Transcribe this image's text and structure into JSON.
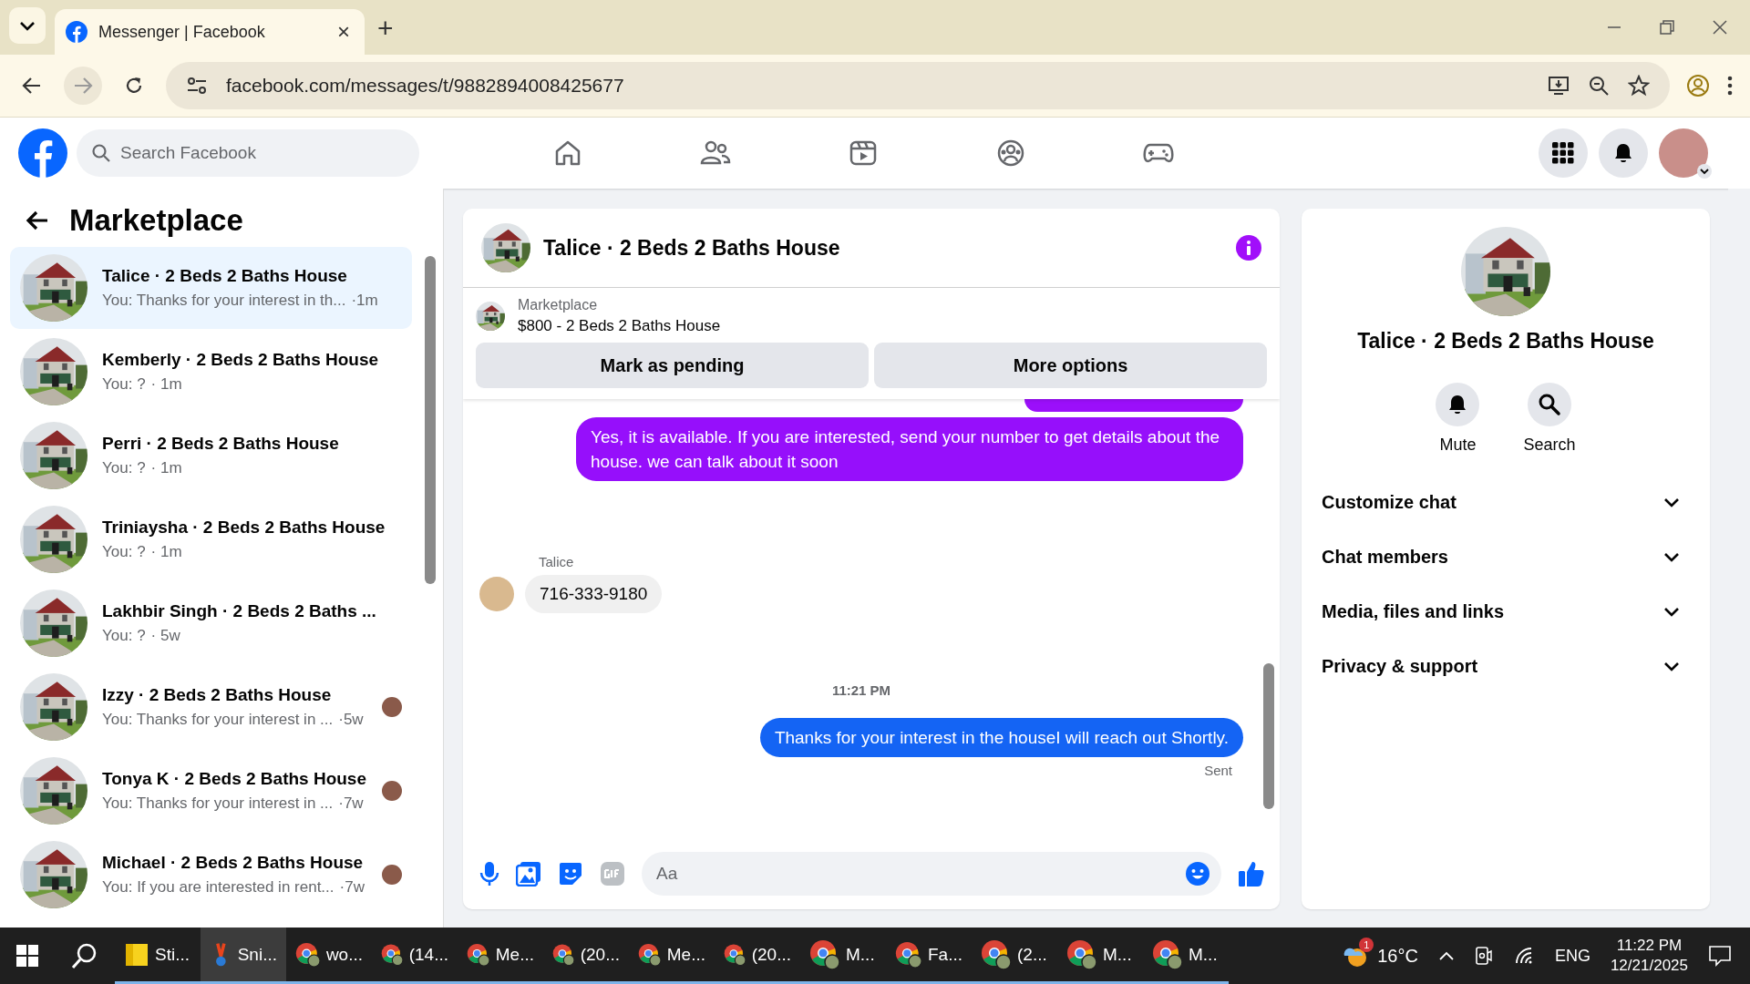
{
  "browser": {
    "tab": {
      "title": "Messenger | Facebook",
      "close": "×"
    },
    "new_tab": "+",
    "url": "facebook.com/messages/t/9882894008425677"
  },
  "header": {
    "search": {
      "placeholder": "Search Facebook"
    }
  },
  "sidebar": {
    "title": "Marketplace",
    "conversations": [
      {
        "name": "Talice · 2 Beds 2 Baths House",
        "preview": "You: Thanks for your interest in th...",
        "time": "·1m",
        "selected": true,
        "seen_avatar": false
      },
      {
        "name": "Kemberly · 2 Beds 2 Baths House",
        "preview": "You: ?",
        "time": "· 1m",
        "selected": false,
        "seen_avatar": false
      },
      {
        "name": "Perri · 2 Beds 2 Baths House",
        "preview": "You: ?",
        "time": "· 1m",
        "selected": false,
        "seen_avatar": false
      },
      {
        "name": "Triniaysha · 2 Beds 2 Baths House",
        "preview": "You: ?",
        "time": "· 1m",
        "selected": false,
        "seen_avatar": false
      },
      {
        "name": "Lakhbir Singh · 2 Beds 2 Baths ...",
        "preview": "You: ?",
        "time": "· 5w",
        "selected": false,
        "seen_avatar": false
      },
      {
        "name": "Izzy · 2 Beds 2 Baths House",
        "preview": "You: Thanks for your interest in ...",
        "time": "·5w",
        "selected": false,
        "seen_avatar": true
      },
      {
        "name": "Tonya K · 2 Beds 2 Baths House",
        "preview": "You: Thanks for your interest in ...",
        "time": "·7w",
        "selected": false,
        "seen_avatar": true
      },
      {
        "name": "Michael · 2 Beds 2 Baths House",
        "preview": "You: If you are interested in rent...",
        "time": "·7w",
        "selected": false,
        "seen_avatar": true
      }
    ]
  },
  "chat": {
    "title": "Talice · 2 Beds 2 Baths House",
    "listing": {
      "source": "Marketplace",
      "title": "$800 - 2 Beds 2 Baths House"
    },
    "actions": [
      "Mark as pending",
      "More options"
    ],
    "messages": [
      {
        "kind": "fragment",
        "color": "#9b0ffa"
      },
      {
        "kind": "outgoing",
        "text": "Yes, it is available. If you are interested, send your number to get details about the house. we can talk about it soon",
        "color": "#960ffb"
      },
      {
        "kind": "incoming",
        "sender": "Talice",
        "text": "716-333-9180"
      },
      {
        "kind": "timestamp",
        "text": "11:21 PM"
      },
      {
        "kind": "outgoing",
        "text": "Thanks for your interest in the houseI will reach out Shortly.",
        "color": "#1464f4",
        "status": "Sent"
      }
    ],
    "composer": {
      "placeholder": "Aa"
    }
  },
  "details": {
    "title": "Talice · 2 Beds 2 Baths House",
    "actions": [
      {
        "kind": "bell",
        "label": "Mute"
      },
      {
        "kind": "search",
        "label": "Search"
      }
    ],
    "sections": [
      {
        "label": "Customize chat",
        "expanded": false
      },
      {
        "label": "Chat members",
        "expanded": false
      },
      {
        "label": "Media, files and links",
        "expanded": false
      },
      {
        "label": "Privacy & support",
        "expanded": false
      }
    ]
  },
  "taskbar": {
    "apps": [
      {
        "kind": "notes",
        "label": "Sti...",
        "selected": false
      },
      {
        "kind": "snip",
        "label": "Sni...",
        "selected": true
      },
      {
        "kind": "chrome",
        "label": "wo...",
        "selected": false
      },
      {
        "kind": "chrome",
        "label": "(14...",
        "selected": false
      },
      {
        "kind": "chrome",
        "label": "Me...",
        "selected": false
      },
      {
        "kind": "chrome",
        "label": "(20...",
        "selected": false
      },
      {
        "kind": "chrome",
        "label": "Me...",
        "selected": false
      },
      {
        "kind": "chrome",
        "label": "(20...",
        "selected": false
      },
      {
        "kind": "chrome",
        "label": "M...",
        "selected": false
      },
      {
        "kind": "chrome",
        "label": "Fa...",
        "selected": false
      },
      {
        "kind": "chrome",
        "label": "(2...",
        "selected": false
      },
      {
        "kind": "chrome",
        "label": "M...",
        "selected": false
      },
      {
        "kind": "chrome",
        "label": "M...",
        "selected": false
      }
    ],
    "weather": {
      "badge": "1",
      "temp": "16°C"
    },
    "language": "ENG",
    "time": "11:22 PM",
    "date": "12/21/2025"
  }
}
